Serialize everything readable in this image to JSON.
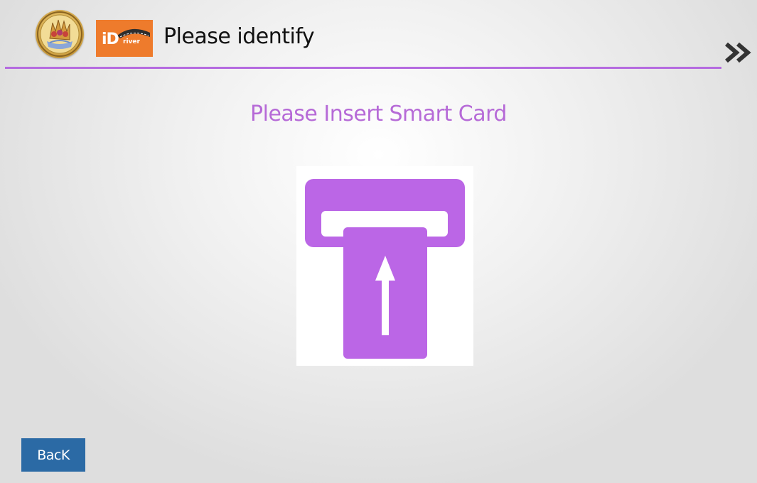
{
  "header": {
    "title": "Please identify",
    "brand_logo_text": "iD",
    "brand_logo_subtext": "river",
    "emblem_icon": "government-seal-icon",
    "next_icon": "double-chevron-right-icon"
  },
  "main": {
    "prompt": "Please Insert Smart Card",
    "illustration_icon": "insert-smart-card-icon"
  },
  "footer": {
    "back_label": "BacK"
  },
  "colors": {
    "accent": "#b56be0",
    "prompt_text": "#b66ad7",
    "button_bg": "#2b6aa5",
    "logo_bg": "#ee7b2c",
    "illustration_purple": "#bb66e6"
  }
}
